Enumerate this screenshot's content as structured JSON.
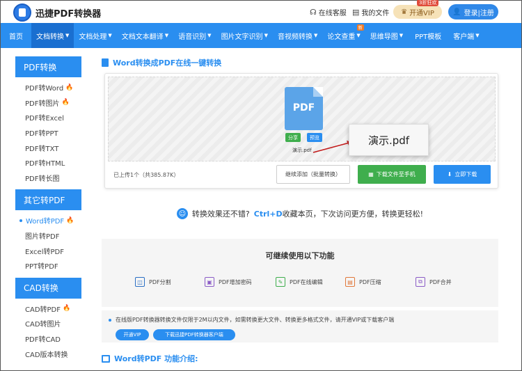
{
  "header": {
    "brand": "迅捷PDF转换器",
    "service_label": "在线客服",
    "docs_label": "我的文件",
    "vip_label": "开通VIP",
    "vip_badge": "3折狂欢",
    "login_label": "登录|注册"
  },
  "nav": {
    "items": [
      {
        "label": "首页",
        "caret": false
      },
      {
        "label": "文档转换",
        "caret": true
      },
      {
        "label": "文档处理",
        "caret": true
      },
      {
        "label": "文档文本翻译",
        "caret": true
      },
      {
        "label": "语音识别",
        "caret": true
      },
      {
        "label": "图片文字识别",
        "caret": true
      },
      {
        "label": "音视频转换",
        "caret": true
      },
      {
        "label": "论文查重",
        "caret": true
      },
      {
        "label": "思维导图",
        "caret": true
      },
      {
        "label": "PPT模板",
        "caret": false
      },
      {
        "label": "客户端",
        "caret": true
      }
    ],
    "new_badge": "新"
  },
  "sidebar": {
    "sections": [
      {
        "title": "PDF转换",
        "items": [
          "PDF转Word",
          "PDF转图片",
          "PDF转Excel",
          "PDF转PPT",
          "PDF转TXT",
          "PDF转HTML",
          "PDF转长图"
        ]
      },
      {
        "title": "其它转PDF",
        "items": [
          "Word转PDF",
          "图片转PDF",
          "Excel转PDF",
          "PPT转PDF"
        ]
      },
      {
        "title": "CAD转换",
        "items": [
          "CAD转PDF",
          "CAD转图片",
          "PDF转CAD",
          "CAD版本转换"
        ]
      }
    ]
  },
  "main": {
    "title": "Word转换成PDF在线一键转换",
    "file_icon_text": "PDF",
    "share_label": "分享",
    "preview_label": "预览",
    "file_name": "演示.pdf",
    "callout_name": "演示.pdf",
    "upload_status": "已上传1个（共385.87K）",
    "continue_label": "继续添加（批量转换）",
    "mobile_label": "下载文件至手机",
    "download_label": "立即下载"
  },
  "promo": {
    "text_a": "转换效果还不错?",
    "shortcut": "Ctrl+D",
    "text_b": "收藏本页，下次访问更方便，转换更轻松!"
  },
  "features": {
    "title": "可继续使用以下功能",
    "items": [
      {
        "label": "PDF分割",
        "icon": "split-icon",
        "glyph": "◫",
        "color": "#2a6fc4"
      },
      {
        "label": "PDF增加密码",
        "icon": "lock-icon",
        "glyph": "🔒",
        "color": "#8a5bc6"
      },
      {
        "label": "PDF在线编辑",
        "icon": "edit-icon",
        "glyph": "✎",
        "color": "#3fae4d"
      },
      {
        "label": "PDF压缩",
        "icon": "compress-icon",
        "glyph": "▤",
        "color": "#e0783a"
      },
      {
        "label": "PDF合并",
        "icon": "merge-icon",
        "glyph": "⧉",
        "color": "#8a5bc6"
      }
    ]
  },
  "notice": {
    "text": "在线版PDF转换器转换文件仅限于2M以内文件，如需转换更大文件、转换更多格式文件，请开通VIP或下载客户端",
    "vip_pill": "开通VIP",
    "client_pill": "下载迅捷PDF转换器客户端"
  },
  "intro": {
    "title": "Word转PDF 功能介绍:"
  },
  "colors": {
    "primary": "#2a8ef0",
    "green": "#3fae4d",
    "fire": "#f5562a"
  }
}
